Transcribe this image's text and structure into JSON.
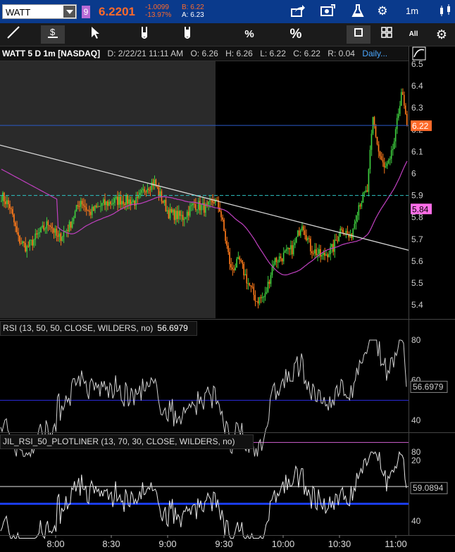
{
  "topbar": {
    "symbol": "WATT",
    "group_badge": "9",
    "last_price": "6.2201",
    "net_change": "-1.0099",
    "percent_change": "-13.97%",
    "bid": "B: 6.22",
    "ask": "A: 6.23",
    "timeframe": "1m",
    "icons": [
      "share-icon",
      "camera-icon",
      "flask-icon",
      "gear-icon",
      "candles-icon"
    ]
  },
  "toolbar": {
    "tools": [
      "line-tool-icon",
      "price-level-icon",
      "cursor-icon",
      "flask-down-icon",
      "flask-up-icon",
      "percent-toggle-icon",
      "percent-icon",
      "single-layout-icon",
      "grid-layout-icon",
      "all-icon",
      "settings-icon"
    ],
    "percent_small": "%",
    "percent_big": "%",
    "all_label": "All"
  },
  "header": {
    "title": "WATT 5 D 1m [NASDAQ]",
    "date": "D: 2/22/21 11:11 AM",
    "open": "O: 6.26",
    "high": "H: 6.26",
    "low": "L: 6.22",
    "close": "C: 6.22",
    "range": "R: 0.04",
    "aggregation": "Daily..."
  },
  "price_axis": {
    "ticks": [
      "6.5",
      "6.4",
      "6.3",
      "6.2",
      "6.1",
      "6",
      "5.9",
      "5.8",
      "5.7",
      "5.6",
      "5.5",
      "5.4"
    ],
    "last_tag": "6.22",
    "ma_tag": "5.84",
    "colors": {
      "last_tag": "#ff6a2a",
      "ma_tag": "#ff6ee8"
    }
  },
  "rsi_panel": {
    "label": "RSI (13, 50, 50, CLOSE, WILDERS, no)",
    "value": "56.6979",
    "ticks": [
      "80",
      "60",
      "40",
      "20"
    ],
    "value_tag": "56.6979",
    "levels": {
      "mid": 50,
      "low": 29
    }
  },
  "plotliner_panel": {
    "label": "JIL_RSI_50_PLOTLINER (13, 70, 30, CLOSE, WILDERS, no)",
    "ticks": [
      "80",
      "60",
      "40"
    ],
    "value_tag": "59.0894",
    "levels": {
      "high": 60,
      "mid": 50
    }
  },
  "time_axis": {
    "labels": [
      "8:00",
      "8:30",
      "9:00",
      "9:30",
      "10:00",
      "10:30",
      "11:00"
    ]
  },
  "colors": {
    "up_candle": "#3fcf3f",
    "down_candle": "#ff7a1a",
    "moving_average": "#c040c0",
    "trend_line": "#d8d8d8",
    "premarket_bg": "#2a2a2a",
    "topbar_bg": "#0a3a8c"
  }
}
